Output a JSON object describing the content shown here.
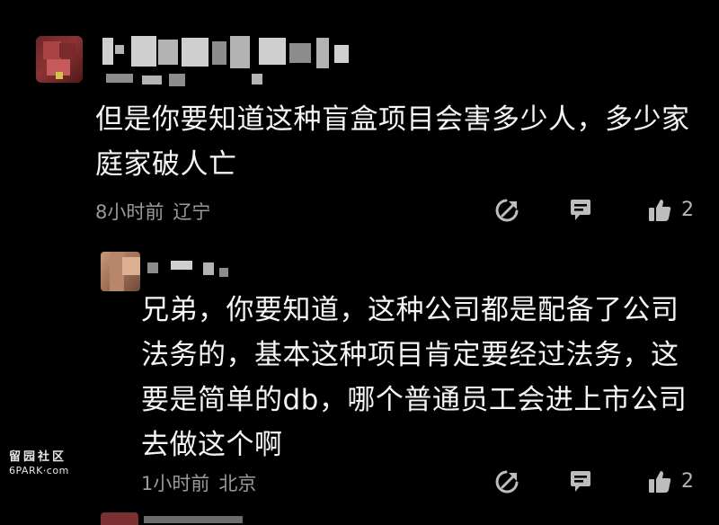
{
  "comments": [
    {
      "body": "但是你要知道这种盲盒项目会害多少人，多少家庭家破人亡",
      "time": "8小时前",
      "location": "辽宁",
      "like_count": "2"
    },
    {
      "body": "兄弟，你要知道，这种公司都是配备了公司法务的，基本这种项目肯定要经过法务，这要是简单的db，哪个普通员工会进上市公司去做这个啊",
      "time": "1小时前",
      "location": "北京",
      "like_count": "2"
    }
  ],
  "watermark": {
    "line1": "留园社区",
    "line2": "6PARK·com"
  },
  "icons": {
    "share": "share-icon",
    "reply": "comment-icon",
    "like": "thumbs-up-icon"
  },
  "colors": {
    "background": "#000000",
    "text": "#f5f5f5",
    "meta": "#9a9a9a",
    "icon": "#bdbdbd"
  }
}
